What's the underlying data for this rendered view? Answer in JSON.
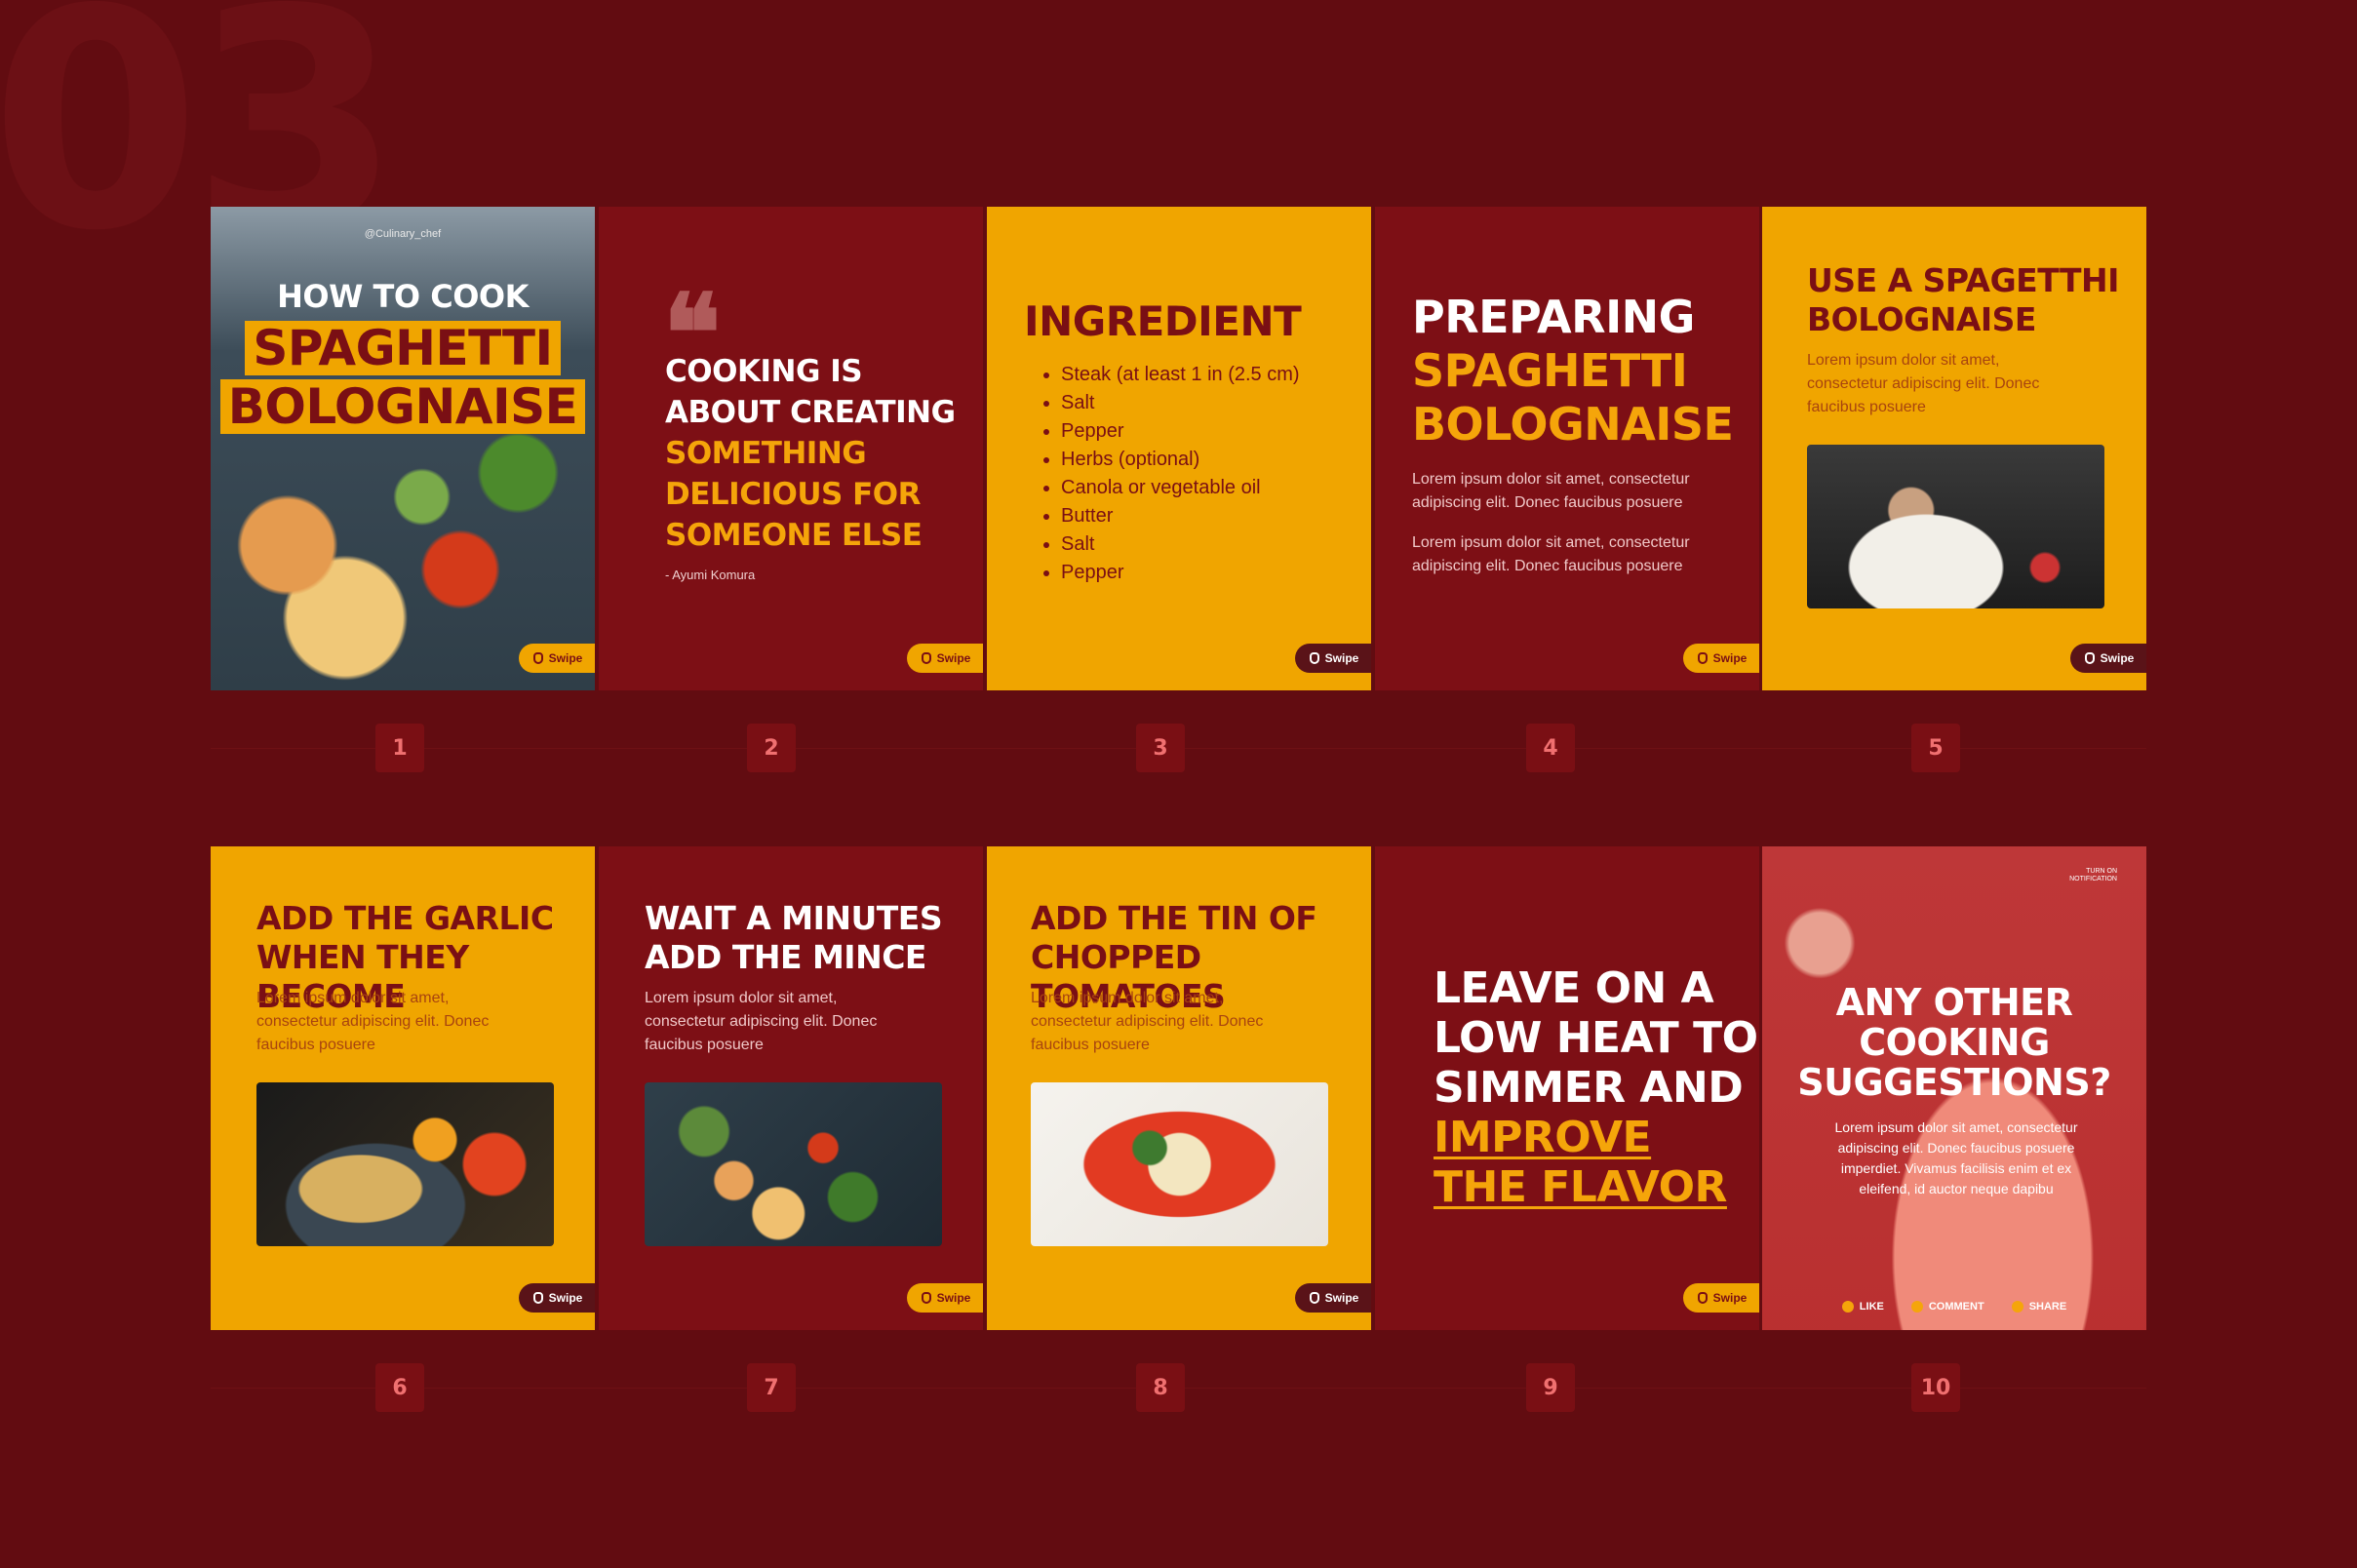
{
  "bignum": "03",
  "swipe_label": "Swipe",
  "cards": {
    "c1": {
      "handle": "@Culinary_chef",
      "line1": "HOW TO COOK",
      "line2": "SPAGHETTI",
      "line3": "BOLOGNAISE"
    },
    "c2": {
      "quote_l1": "COOKING IS",
      "quote_l2": "ABOUT CREATING",
      "quote_l3": "SOMETHING",
      "quote_l4": "DELICIOUS FOR",
      "quote_l5": "SOMEONE ELSE",
      "author": "- Ayumi Komura"
    },
    "c3": {
      "title": "INGREDIENT",
      "items": [
        "Steak (at least 1 in (2.5 cm)",
        "Salt",
        "Pepper",
        "Herbs (optional)",
        "Canola or vegetable oil",
        "Butter",
        "Salt",
        "Pepper"
      ]
    },
    "c4": {
      "l1": "PREPARING",
      "l2": "SPAGHETTI",
      "l3": "BOLOGNAISE",
      "p1": "Lorem ipsum dolor sit amet, consectetur adipiscing elit. Donec faucibus posuere",
      "p2": "Lorem ipsum dolor sit amet, consectetur adipiscing elit. Donec faucibus posuere"
    },
    "c5": {
      "l1": "USE A SPAGETTHI",
      "l2": "BOLOGNAISE",
      "p": "Lorem ipsum dolor sit amet, consectetur adipiscing elit. Donec faucibus posuere"
    },
    "c6": {
      "l1": "ADD THE GARLIC",
      "l2": "WHEN THEY BECOME",
      "p": "Lorem ipsum dolor sit amet, consectetur adipiscing elit. Donec faucibus posuere"
    },
    "c7": {
      "l1": "WAIT A MINUTES",
      "l2": "ADD THE MINCE",
      "p": "Lorem ipsum dolor sit amet, consectetur adipiscing elit. Donec faucibus posuere"
    },
    "c8": {
      "l1": "ADD THE TIN OF",
      "l2": "CHOPPED TOMATOES",
      "p": "Lorem ipsum dolor sit amet, consectetur adipiscing elit. Donec faucibus posuere"
    },
    "c9": {
      "l1": "LEAVE ON A",
      "l2": "LOW HEAT TO",
      "l3": "SIMMER AND",
      "l4": "IMPROVE",
      "l5": "THE FLAVOR"
    },
    "c10": {
      "notify": "TURN ON NOTIFICATION",
      "l1": "ANY OTHER",
      "l2": "COOKING",
      "l3": "SUGGESTIONS?",
      "p": "Lorem ipsum dolor sit amet, consectetur adipiscing elit. Donec faucibus posuere imperdiet. Vivamus facilisis enim et ex eleifend, id auctor neque dapibu",
      "like": "LIKE",
      "comment": "COMMENT",
      "share": "SHARE"
    }
  },
  "numbers": [
    "1",
    "2",
    "3",
    "4",
    "5",
    "6",
    "7",
    "8",
    "9",
    "10"
  ]
}
